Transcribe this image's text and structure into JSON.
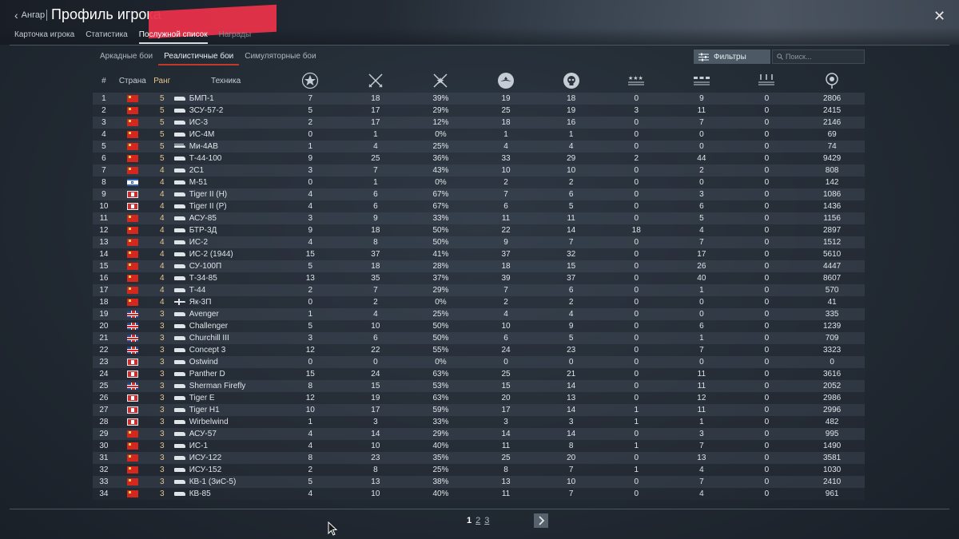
{
  "header": {
    "back_label": "Ангар",
    "title": "Профиль игрока",
    "close_glyph": "✕",
    "tabs": [
      {
        "label": "Карточка игрока",
        "state": "normal"
      },
      {
        "label": "Статистика",
        "state": "normal"
      },
      {
        "label": "Послужной список",
        "state": "active"
      },
      {
        "label": "Награды",
        "state": "dim"
      }
    ]
  },
  "modes": {
    "tabs": [
      "Аркадные бои",
      "Реалистичные бои",
      "Симуляторные бои"
    ],
    "active_index": 1,
    "filter_label": "Фильтры",
    "search_placeholder": "Поиск..."
  },
  "table": {
    "columns": {
      "num": "#",
      "country": "Страна",
      "rank": "Ранг",
      "vehicle": "Техника"
    },
    "stat_column_icons": [
      "battles-icon",
      "respawns-icon",
      "victories-icon",
      "air-kills-icon",
      "ground-kills-icon",
      "naval-kills-icon",
      "ground-targets-icon",
      "naval-targets-icon",
      "score-icon"
    ],
    "rows": [
      {
        "n": "1",
        "c": "ussr",
        "r": "5",
        "v": "tank",
        "name": "БМП-1",
        "s": [
          "7",
          "18",
          "39%",
          "19",
          "18",
          "0",
          "9",
          "0",
          "2806"
        ]
      },
      {
        "n": "2",
        "c": "ussr",
        "r": "5",
        "v": "tank",
        "name": "ЗСУ-57-2",
        "s": [
          "5",
          "17",
          "29%",
          "25",
          "19",
          "3",
          "11",
          "0",
          "2415"
        ]
      },
      {
        "n": "3",
        "c": "ussr",
        "r": "5",
        "v": "tank",
        "name": "ИС-3",
        "s": [
          "2",
          "17",
          "12%",
          "18",
          "16",
          "0",
          "7",
          "0",
          "2146"
        ]
      },
      {
        "n": "4",
        "c": "ussr",
        "r": "5",
        "v": "tank",
        "name": "ИС-4М",
        "s": [
          "0",
          "1",
          "0%",
          "1",
          "1",
          "0",
          "0",
          "0",
          "69"
        ]
      },
      {
        "n": "5",
        "c": "ussr",
        "r": "5",
        "v": "heli",
        "name": "Ми-4АВ",
        "s": [
          "1",
          "4",
          "25%",
          "4",
          "4",
          "0",
          "0",
          "0",
          "74"
        ]
      },
      {
        "n": "6",
        "c": "ussr",
        "r": "5",
        "v": "tank",
        "name": "Т-44-100",
        "s": [
          "9",
          "25",
          "36%",
          "33",
          "29",
          "2",
          "44",
          "0",
          "9429"
        ]
      },
      {
        "n": "7",
        "c": "ussr",
        "r": "4",
        "v": "tank",
        "name": "2С1",
        "s": [
          "3",
          "7",
          "43%",
          "10",
          "10",
          "0",
          "2",
          "0",
          "808"
        ]
      },
      {
        "n": "8",
        "c": "israel",
        "r": "4",
        "v": "tank",
        "name": "М-51",
        "s": [
          "0",
          "1",
          "0%",
          "2",
          "2",
          "0",
          "0",
          "0",
          "142"
        ]
      },
      {
        "n": "9",
        "c": "germany",
        "r": "4",
        "v": "tank",
        "name": "Tiger II (H)",
        "s": [
          "4",
          "6",
          "67%",
          "7",
          "6",
          "0",
          "3",
          "0",
          "1086"
        ]
      },
      {
        "n": "10",
        "c": "germany",
        "r": "4",
        "v": "tank",
        "name": "Tiger II (P)",
        "s": [
          "4",
          "6",
          "67%",
          "6",
          "5",
          "0",
          "6",
          "0",
          "1436"
        ]
      },
      {
        "n": "11",
        "c": "ussr",
        "r": "4",
        "v": "tank",
        "name": "АСУ-85",
        "s": [
          "3",
          "9",
          "33%",
          "11",
          "11",
          "0",
          "5",
          "0",
          "1156"
        ]
      },
      {
        "n": "12",
        "c": "ussr",
        "r": "4",
        "v": "tank",
        "name": "БТР-3Д",
        "s": [
          "9",
          "18",
          "50%",
          "22",
          "14",
          "18",
          "4",
          "0",
          "2897"
        ]
      },
      {
        "n": "13",
        "c": "ussr",
        "r": "4",
        "v": "tank",
        "name": "ИС-2",
        "s": [
          "4",
          "8",
          "50%",
          "9",
          "7",
          "0",
          "7",
          "0",
          "1512"
        ]
      },
      {
        "n": "14",
        "c": "ussr",
        "r": "4",
        "v": "tank",
        "name": "ИС-2 (1944)",
        "s": [
          "15",
          "37",
          "41%",
          "37",
          "32",
          "0",
          "17",
          "0",
          "5610"
        ]
      },
      {
        "n": "15",
        "c": "ussr",
        "r": "4",
        "v": "tank",
        "name": "СУ-100П",
        "s": [
          "5",
          "18",
          "28%",
          "18",
          "15",
          "0",
          "26",
          "0",
          "4447"
        ]
      },
      {
        "n": "16",
        "c": "ussr",
        "r": "4",
        "v": "tank",
        "name": "Т-34-85",
        "s": [
          "13",
          "35",
          "37%",
          "39",
          "37",
          "0",
          "40",
          "0",
          "8607"
        ]
      },
      {
        "n": "17",
        "c": "ussr",
        "r": "4",
        "v": "tank",
        "name": "Т-44",
        "s": [
          "2",
          "7",
          "29%",
          "7",
          "6",
          "0",
          "1",
          "0",
          "570"
        ]
      },
      {
        "n": "18",
        "c": "ussr",
        "r": "4",
        "v": "plane",
        "name": "Як-3П",
        "s": [
          "0",
          "2",
          "0%",
          "2",
          "2",
          "0",
          "0",
          "0",
          "41"
        ]
      },
      {
        "n": "19",
        "c": "uk",
        "r": "3",
        "v": "tank",
        "name": "Avenger",
        "s": [
          "1",
          "4",
          "25%",
          "4",
          "4",
          "0",
          "0",
          "0",
          "335"
        ]
      },
      {
        "n": "20",
        "c": "uk",
        "r": "3",
        "v": "tank",
        "name": "Challenger",
        "s": [
          "5",
          "10",
          "50%",
          "10",
          "9",
          "0",
          "6",
          "0",
          "1239"
        ]
      },
      {
        "n": "21",
        "c": "uk",
        "r": "3",
        "v": "tank",
        "name": "Churchill III",
        "s": [
          "3",
          "6",
          "50%",
          "6",
          "5",
          "0",
          "1",
          "0",
          "709"
        ]
      },
      {
        "n": "22",
        "c": "uk",
        "r": "3",
        "v": "tank",
        "name": "Concept 3",
        "s": [
          "12",
          "22",
          "55%",
          "24",
          "23",
          "0",
          "7",
          "0",
          "3323"
        ]
      },
      {
        "n": "23",
        "c": "germany",
        "r": "3",
        "v": "tank",
        "name": "Ostwind",
        "s": [
          "0",
          "0",
          "0%",
          "0",
          "0",
          "0",
          "0",
          "0",
          "0"
        ]
      },
      {
        "n": "24",
        "c": "germany",
        "r": "3",
        "v": "tank",
        "name": "Panther D",
        "s": [
          "15",
          "24",
          "63%",
          "25",
          "21",
          "0",
          "11",
          "0",
          "3616"
        ]
      },
      {
        "n": "25",
        "c": "uk",
        "r": "3",
        "v": "tank",
        "name": "Sherman Firefly",
        "s": [
          "8",
          "15",
          "53%",
          "15",
          "14",
          "0",
          "11",
          "0",
          "2052"
        ]
      },
      {
        "n": "26",
        "c": "germany",
        "r": "3",
        "v": "tank",
        "name": "Tiger E",
        "s": [
          "12",
          "19",
          "63%",
          "20",
          "13",
          "0",
          "12",
          "0",
          "2986"
        ]
      },
      {
        "n": "27",
        "c": "germany",
        "r": "3",
        "v": "tank",
        "name": "Tiger H1",
        "s": [
          "10",
          "17",
          "59%",
          "17",
          "14",
          "1",
          "11",
          "0",
          "2996"
        ]
      },
      {
        "n": "28",
        "c": "germany",
        "r": "3",
        "v": "tank",
        "name": "Wirbelwind",
        "s": [
          "1",
          "3",
          "33%",
          "3",
          "3",
          "1",
          "1",
          "0",
          "482"
        ]
      },
      {
        "n": "29",
        "c": "ussr",
        "r": "3",
        "v": "tank",
        "name": "АСУ-57",
        "s": [
          "4",
          "14",
          "29%",
          "14",
          "14",
          "0",
          "3",
          "0",
          "995"
        ]
      },
      {
        "n": "30",
        "c": "ussr",
        "r": "3",
        "v": "tank",
        "name": "ИС-1",
        "s": [
          "4",
          "10",
          "40%",
          "11",
          "8",
          "1",
          "7",
          "0",
          "1490"
        ]
      },
      {
        "n": "31",
        "c": "ussr",
        "r": "3",
        "v": "tank",
        "name": "ИСУ-122",
        "s": [
          "8",
          "23",
          "35%",
          "25",
          "20",
          "0",
          "13",
          "0",
          "3581"
        ]
      },
      {
        "n": "32",
        "c": "ussr",
        "r": "3",
        "v": "tank",
        "name": "ИСУ-152",
        "s": [
          "2",
          "8",
          "25%",
          "8",
          "7",
          "1",
          "4",
          "0",
          "1030"
        ]
      },
      {
        "n": "33",
        "c": "ussr",
        "r": "3",
        "v": "tank",
        "name": "КВ-1 (ЗиС-5)",
        "s": [
          "5",
          "13",
          "38%",
          "13",
          "10",
          "0",
          "7",
          "0",
          "2410"
        ]
      },
      {
        "n": "34",
        "c": "ussr",
        "r": "3",
        "v": "tank",
        "name": "КВ-85",
        "s": [
          "4",
          "10",
          "40%",
          "11",
          "7",
          "0",
          "4",
          "0",
          "961"
        ]
      }
    ]
  },
  "pagination": {
    "pages": [
      "1",
      "2",
      "3"
    ],
    "current": "1",
    "next_glyph": "›"
  },
  "colors": {
    "rank": "#e6c78a",
    "active_tab_underline": "#c0392b",
    "redaction": "#e8324a"
  }
}
